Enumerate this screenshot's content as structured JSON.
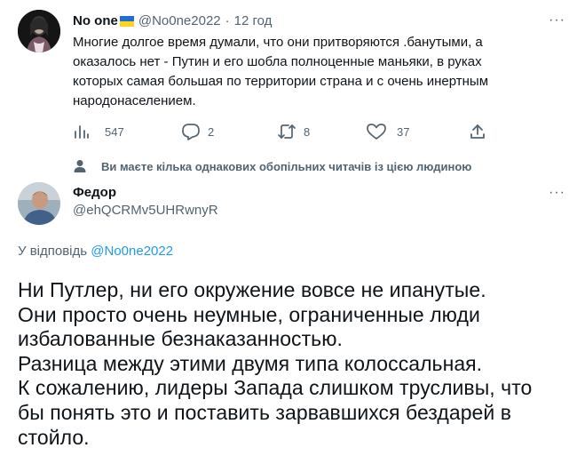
{
  "parent_tweet": {
    "author_name": "No one",
    "flag": "🇺🇦",
    "handle": "@No0ne2022",
    "separator": "·",
    "time": "12 год",
    "text_lines": [
      "Многие долгое время думали, что они притворяются .банутыми, а",
      "оказалось нет - Путин и его шобла полноценные маньяки, в руках",
      "которых самая большая по территории страна и с очень инертным",
      "народонаселением."
    ],
    "stats": {
      "views": "547",
      "replies": "2",
      "retweets": "8",
      "likes": "37"
    }
  },
  "mutual_followers_notice": "Ви маєте кілька однакових обопільних читачів із цією людиною",
  "reply_tweet": {
    "author_name": "Федор",
    "handle": "@ehQCRMv5UHRwnyR",
    "replying_to_label": "У відповідь",
    "replying_to_handle": "@No0ne2022",
    "text_lines": [
      "Ни Путлер, ни его окружение вовсе не ипанутые.",
      "Они просто очень неумные, ограниченные люди",
      "избалованные безнаказанностью.",
      "Разница между этими двумя типа колоссальная.",
      "К сожалению, лидеры Запада слишком трусливы, что",
      "бы понять это и поставить зарвавшихся бездарей в",
      "стойло."
    ]
  },
  "icons": [
    "more-icon",
    "views-icon",
    "reply-icon",
    "retweet-icon",
    "like-icon",
    "share-icon",
    "person-icon"
  ],
  "colors": {
    "text": "#0f1419",
    "muted": "#536471",
    "link": "#1d9bf0",
    "thread_line": "#cfd9de"
  }
}
